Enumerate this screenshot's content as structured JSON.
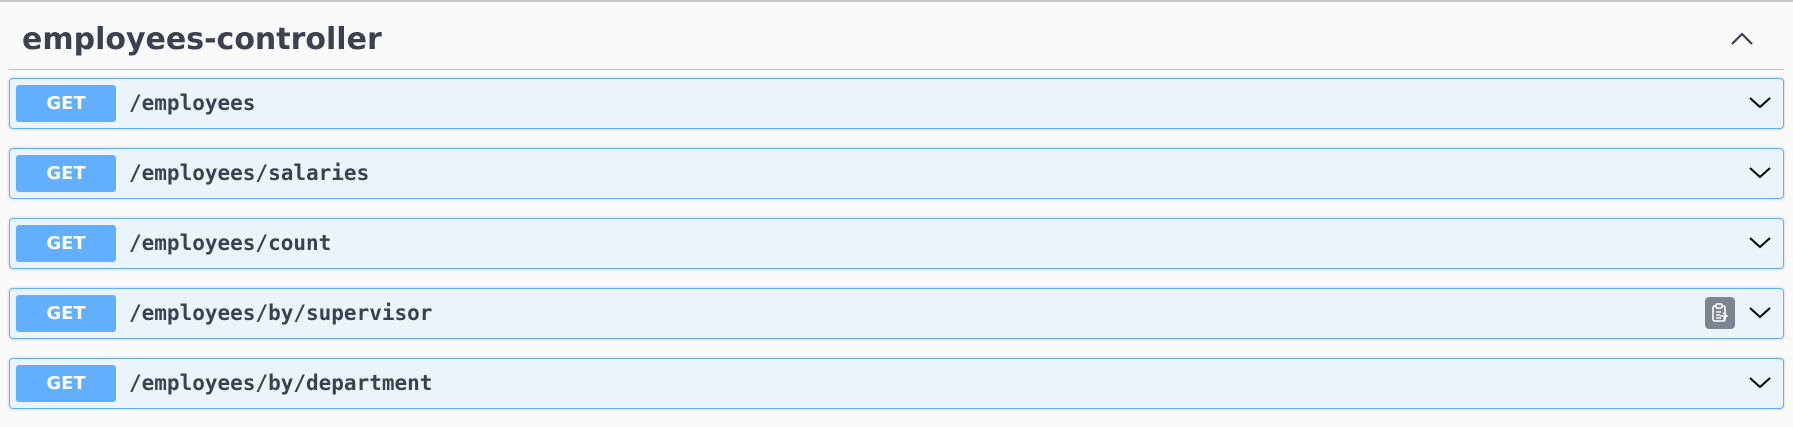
{
  "section": {
    "title": "employees-controller",
    "collapse_icon": "chevron-up-icon"
  },
  "operations": [
    {
      "method": "GET",
      "path": "/employees",
      "expand_icon": "chevron-down-icon"
    },
    {
      "method": "GET",
      "path": "/employees/salaries",
      "expand_icon": "chevron-down-icon"
    },
    {
      "method": "GET",
      "path": "/employees/count",
      "expand_icon": "chevron-down-icon"
    },
    {
      "method": "GET",
      "path": "/employees/by/supervisor",
      "expand_icon": "chevron-down-icon",
      "copy_icon": "copy-to-clipboard-icon"
    },
    {
      "method": "GET",
      "path": "/employees/by/department",
      "expand_icon": "chevron-down-icon"
    }
  ],
  "colors": {
    "get_accent": "#61affe",
    "get_background": "#ebf3fb",
    "text": "#3b4151",
    "copy_button": "#7d8492"
  }
}
